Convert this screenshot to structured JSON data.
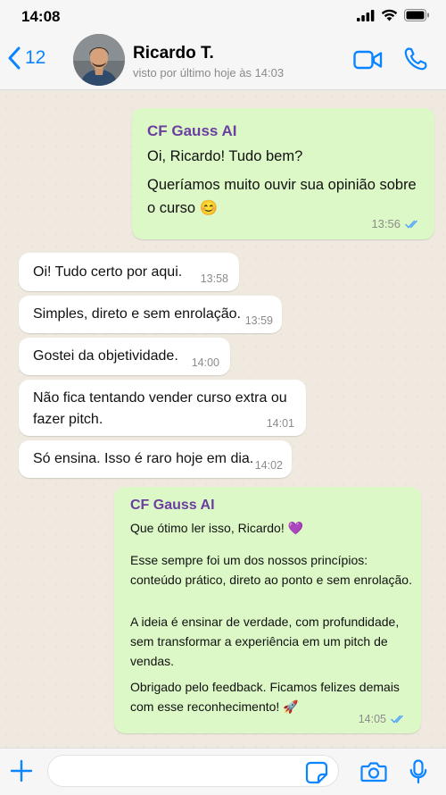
{
  "status_bar": {
    "time": "14:08"
  },
  "header": {
    "back_count": "12",
    "contact_name": "Ricardo T.",
    "contact_status": "visto por último hoje às 14:03"
  },
  "messages": [
    {
      "sender": "CF Gauss AI",
      "lines": [
        "Oi, Ricardo! Tudo bem?",
        "Queríamos muito ouvir sua opinião sobre o curso 😊"
      ],
      "time": "13:56"
    },
    {
      "text": "Oi! Tudo certo por aqui.",
      "time": "13:58"
    },
    {
      "text": "Simples, direto e sem enrolação.",
      "time": "13:59"
    },
    {
      "text": "Gostei da objetividade.",
      "time": "14:00"
    },
    {
      "text": "Não fica tentando vender curso extra ou fazer pitch.",
      "time": "14:01"
    },
    {
      "text": "Só ensina. Isso é raro hoje em dia.",
      "time": "14:02"
    },
    {
      "sender": "CF Gauss AI",
      "paragraphs": [
        "Que ótimo ler isso, Ricardo! 💜",
        "Esse sempre foi um dos nossos princípios: conteúdo prático, direto ao ponto e sem enrolação.",
        "A ideia é ensinar de verdade, com profundidade, sem transformar a experiência em um pitch de vendas.",
        "Obrigado pelo feedback. Ficamos felizes demais com esse reconhecimento! 🚀"
      ],
      "time": "14:05"
    }
  ],
  "colors": {
    "accent": "#0a84ff",
    "outgoing_bubble": "#dcf8c6",
    "incoming_bubble": "#ffffff",
    "sender_name": "#6b3fa0",
    "read_ticks": "#4fa3ff"
  },
  "icons": [
    "back-chevron-icon",
    "video-call-icon",
    "phone-icon",
    "plus-icon",
    "sticker-icon",
    "camera-icon",
    "microphone-icon",
    "read-ticks-icon"
  ]
}
